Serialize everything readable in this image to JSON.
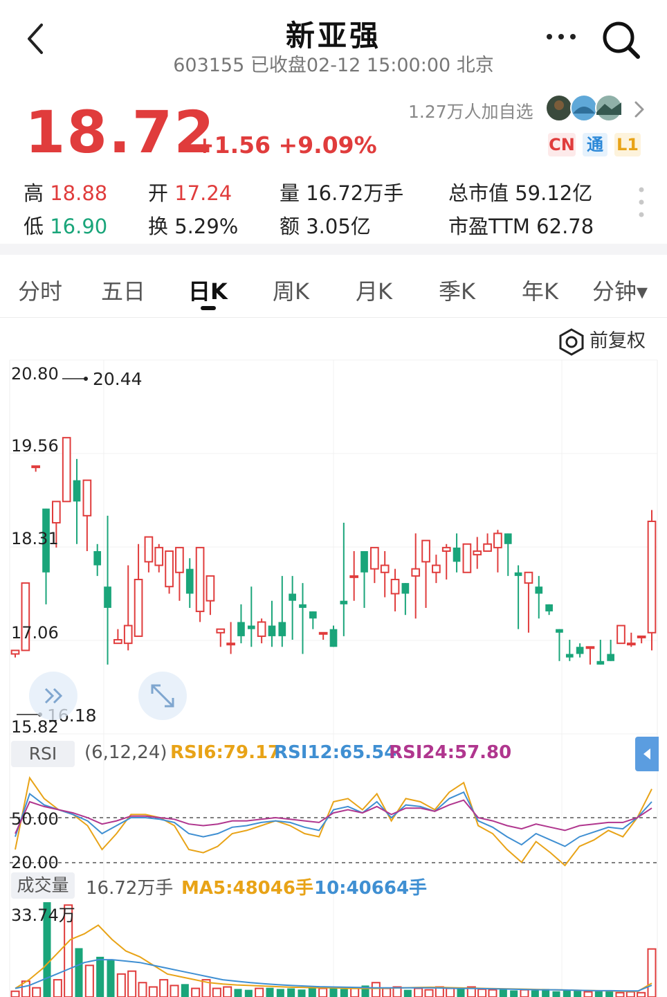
{
  "header": {
    "title": "新亚强",
    "subtitle": "603155 已收盘02-12 15:00:00 北京"
  },
  "quote": {
    "price": "18.72",
    "change": "+1.56 +9.09%",
    "watchers": "1.27万人加自选",
    "badges": [
      "CN",
      "通",
      "L1"
    ]
  },
  "stats": {
    "high_label": "高",
    "high_value": "18.88",
    "low_label": "低",
    "low_value": "16.90",
    "open_label": "开",
    "open_value": "17.24",
    "turnover_label": "换",
    "turnover_value": "5.29%",
    "volume_label": "量",
    "volume_value": "16.72万手",
    "amount_label": "额",
    "amount_value": "3.05亿",
    "mktcap_label": "总市值",
    "mktcap_value": "59.12亿",
    "pe_label": "市盈TTM",
    "pe_value": "62.78"
  },
  "tabs": [
    "分时",
    "五日",
    "日K",
    "周K",
    "月K",
    "季K",
    "年K",
    "分钟▾"
  ],
  "active_tab": "日K",
  "adjust_label": "前复权",
  "colors": {
    "up": "#e03c3c",
    "down": "#1aa57a",
    "ma5": "#e8a317",
    "ma10": "#3f8fd2",
    "rsi24": "#b0368e"
  },
  "chart_data": [
    {
      "type": "candlestick",
      "y_ticks": [
        "20.80",
        "19.56",
        "18.31",
        "17.06",
        "15.82"
      ],
      "ylim": [
        15.82,
        20.8
      ],
      "max_marker": "20.44",
      "min_marker": "16.18",
      "candles": [
        [
          16.85,
          16.9,
          16.7,
          16.8
        ],
        [
          16.9,
          17.85,
          16.9,
          17.8
        ],
        [
          19.5,
          19.5,
          19.4,
          19.42
        ],
        [
          18.9,
          18.0,
          18.9,
          17.55
        ],
        [
          18.7,
          19.0,
          17.9,
          18.35
        ],
        [
          19.0,
          19.9,
          18.4,
          19.2
        ],
        [
          19.3,
          19.0,
          19.6,
          18.4
        ],
        [
          18.8,
          19.3,
          18.7,
          18.3
        ],
        [
          18.3,
          18.1,
          18.4,
          17.95
        ],
        [
          17.8,
          17.5,
          18.8,
          16.7
        ],
        [
          17.0,
          17.05,
          17.2,
          17.0
        ],
        [
          17.0,
          17.25,
          18.1,
          16.9
        ],
        [
          17.1,
          17.9,
          18.4,
          17.1
        ],
        [
          18.15,
          18.5,
          18.45,
          18.0
        ],
        [
          18.1,
          18.35,
          18.4,
          18.0
        ],
        [
          17.8,
          18.3,
          18.05,
          17.7
        ],
        [
          18.0,
          18.35,
          17.8,
          17.6
        ],
        [
          18.05,
          17.7,
          18.2,
          17.5
        ],
        [
          17.45,
          18.35,
          17.45,
          17.3
        ],
        [
          17.6,
          17.95,
          17.35,
          17.4
        ],
        [
          17.15,
          17.2,
          17.2,
          16.95
        ],
        [
          17.0,
          17.0,
          17.3,
          16.85
        ],
        [
          17.3,
          17.1,
          17.55,
          17.0
        ],
        [
          17.25,
          17.2,
          17.8,
          16.95
        ],
        [
          17.1,
          17.3,
          17.35,
          17.0
        ],
        [
          17.25,
          17.1,
          17.6,
          16.95
        ],
        [
          17.3,
          17.1,
          17.95,
          16.95
        ],
        [
          17.7,
          17.6,
          17.95,
          17.05
        ],
        [
          17.55,
          17.5,
          17.85,
          16.85
        ],
        [
          17.45,
          17.35,
          17.0,
          17.2
        ],
        [
          17.15,
          17.15,
          17.1,
          17.05
        ],
        [
          17.2,
          16.95,
          17.25,
          17.1
        ],
        [
          17.6,
          17.55,
          18.7,
          17.1
        ],
        [
          17.95,
          17.95,
          18.3,
          17.6
        ],
        [
          18.3,
          18.0,
          18.3,
          17.5
        ],
        [
          18.05,
          18.35,
          17.95,
          17.85
        ],
        [
          18.0,
          18.1,
          18.3,
          17.65
        ],
        [
          17.7,
          17.9,
          18.05,
          17.45
        ],
        [
          17.85,
          17.7,
          17.5,
          17.4
        ],
        [
          17.95,
          18.05,
          18.55,
          17.35
        ],
        [
          18.15,
          18.45,
          17.95,
          17.5
        ],
        [
          18.0,
          18.1,
          18.25,
          17.85
        ],
        [
          18.3,
          18.35,
          18.4,
          17.9
        ],
        [
          18.35,
          18.15,
          18.55,
          18.0
        ],
        [
          18.0,
          18.4,
          18.35,
          18.0
        ],
        [
          18.25,
          18.3,
          18.5,
          18.05
        ],
        [
          18.3,
          18.4,
          18.55,
          18.3
        ],
        [
          18.35,
          18.55,
          18.6,
          18.0
        ],
        [
          18.55,
          18.4,
          18.45,
          17.95
        ],
        [
          18.0,
          17.95,
          18.1,
          17.2
        ],
        [
          17.85,
          18.0,
          17.75,
          17.15
        ],
        [
          17.8,
          17.7,
          17.95,
          17.35
        ],
        [
          17.55,
          17.45,
          17.45,
          17.4
        ],
        [
          17.2,
          17.15,
          17.2,
          16.75
        ],
        [
          16.85,
          16.8,
          17.05,
          16.75
        ],
        [
          16.95,
          16.85,
          17.0,
          16.8
        ],
        [
          16.95,
          16.95,
          16.8,
          16.7
        ],
        [
          16.75,
          16.7,
          17.05,
          16.7
        ],
        [
          16.85,
          16.75,
          17.05,
          16.8
        ],
        [
          17.0,
          17.25,
          17.1,
          17.0
        ],
        [
          17.0,
          17.0,
          17.15,
          16.95
        ],
        [
          17.1,
          17.1,
          17.05,
          17.0
        ],
        [
          17.15,
          18.72,
          18.88,
          16.9
        ]
      ]
    },
    {
      "type": "line",
      "title": "RSI",
      "params": "(6,12,24)",
      "legend": {
        "rsi6": "RSI6:79.17",
        "rsi12": "RSI12:65.54",
        "rsi24": "RSI24:57.80"
      },
      "y_ticks": [
        "50.00",
        "20.00"
      ],
      "ylim": [
        20,
        80
      ],
      "series": [
        {
          "name": "RSI6",
          "values": [
            30,
            75,
            62,
            55,
            52,
            45,
            30,
            40,
            52,
            52,
            50,
            45,
            30,
            28,
            32,
            40,
            42,
            45,
            48,
            45,
            40,
            38,
            60,
            62,
            55,
            65,
            48,
            62,
            60,
            55,
            66,
            72,
            45,
            40,
            30,
            22,
            35,
            28,
            20,
            32,
            36,
            42,
            38,
            50,
            68
          ]
        },
        {
          "name": "RSI12",
          "values": [
            38,
            65,
            58,
            55,
            52,
            48,
            40,
            45,
            50,
            50,
            49,
            47,
            40,
            38,
            40,
            44,
            45,
            47,
            48,
            47,
            44,
            42,
            55,
            57,
            53,
            60,
            50,
            58,
            57,
            54,
            62,
            66,
            48,
            44,
            38,
            33,
            40,
            36,
            32,
            38,
            41,
            44,
            43,
            50,
            60
          ]
        },
        {
          "name": "RSI24",
          "values": [
            40,
            60,
            57,
            55,
            53,
            50,
            46,
            48,
            51,
            51,
            50,
            49,
            46,
            45,
            46,
            48,
            48,
            49,
            50,
            49,
            48,
            47,
            53,
            55,
            53,
            57,
            52,
            56,
            56,
            54,
            58,
            61,
            50,
            48,
            45,
            43,
            46,
            44,
            42,
            45,
            46,
            47,
            47,
            50,
            56
          ]
        }
      ]
    },
    {
      "type": "bar",
      "title": "成交量",
      "legend": {
        "vol": "16.72万手",
        "ma5": "MA5:48046手",
        "ma10": "10:40664手"
      },
      "y_ticks": [
        "33.74万"
      ],
      "ylim": [
        0,
        33.74
      ],
      "unit": "万手",
      "values": [
        2.0,
        5.5,
        3.2,
        33.0,
        6.0,
        32.0,
        17.0,
        11.0,
        14.0,
        13.0,
        8.0,
        9.0,
        5.0,
        3.5,
        6.0,
        4.0,
        4.5,
        3.0,
        6.0,
        3.0,
        3.5,
        2.8,
        2.5,
        3.0,
        3.2,
        2.8,
        3.0,
        2.6,
        3.5,
        3.0,
        3.2,
        2.8,
        3.0,
        4.0,
        5.0,
        3.0,
        3.5,
        2.5,
        3.0,
        2.5,
        3.5,
        3.0,
        2.8,
        3.5,
        2.7,
        2.5,
        2.8,
        2.3,
        2.5,
        2.3,
        2.8,
        2.0,
        2.5,
        2.2,
        1.8,
        2.0,
        2.0,
        1.5,
        1.8,
        1.5,
        16.72
      ],
      "series": [
        {
          "name": "MA5",
          "values": [
            3,
            6,
            10,
            15,
            20,
            22,
            25,
            20,
            16,
            14,
            11,
            8,
            7,
            6,
            5,
            4.5,
            4.2,
            4.0,
            3.8,
            3.6,
            3.4,
            3.3,
            3.2,
            3.2,
            3.0,
            3.0,
            3.0,
            3.1,
            3.2,
            3.3,
            3.4,
            3.3,
            3.2,
            3.1,
            3.0,
            2.9,
            2.8,
            2.7,
            2.6,
            2.5,
            2.4,
            2.3,
            2.2,
            2.1,
            2.0,
            2.0,
            4.8
          ]
        },
        {
          "name": "MA10",
          "values": [
            3,
            4,
            6,
            8,
            10,
            12,
            13,
            13,
            12.5,
            12,
            11,
            10,
            9,
            8,
            7,
            6,
            5.5,
            5,
            4.6,
            4.3,
            4.0,
            3.8,
            3.6,
            3.5,
            3.4,
            3.3,
            3.2,
            3.2,
            3.2,
            3.2,
            3.2,
            3.1,
            3.0,
            3.0,
            2.9,
            2.8,
            2.7,
            2.6,
            2.5,
            2.5,
            2.4,
            2.3,
            2.2,
            2.2,
            2.1,
            2.1,
            4.07
          ]
        }
      ]
    }
  ]
}
